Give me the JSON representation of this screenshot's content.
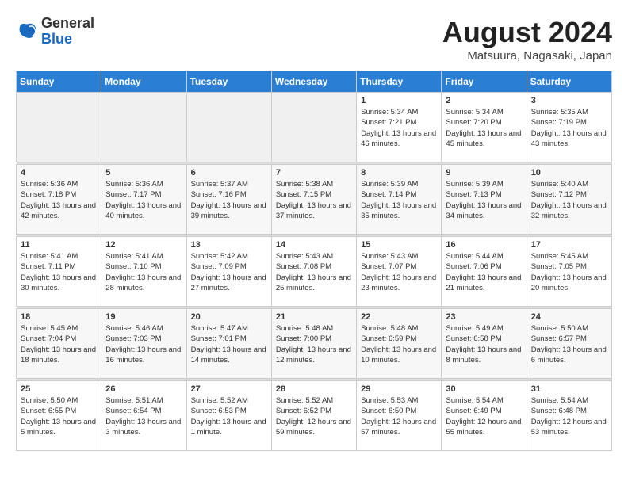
{
  "logo": {
    "general": "General",
    "blue": "Blue"
  },
  "header": {
    "month_year": "August 2024",
    "location": "Matsuura, Nagasaki, Japan"
  },
  "days_of_week": [
    "Sunday",
    "Monday",
    "Tuesday",
    "Wednesday",
    "Thursday",
    "Friday",
    "Saturday"
  ],
  "weeks": [
    [
      {
        "day": "",
        "empty": true
      },
      {
        "day": "",
        "empty": true
      },
      {
        "day": "",
        "empty": true
      },
      {
        "day": "",
        "empty": true
      },
      {
        "day": "1",
        "sunrise": "5:34 AM",
        "sunset": "7:21 PM",
        "daylight": "13 hours and 46 minutes."
      },
      {
        "day": "2",
        "sunrise": "5:34 AM",
        "sunset": "7:20 PM",
        "daylight": "13 hours and 45 minutes."
      },
      {
        "day": "3",
        "sunrise": "5:35 AM",
        "sunset": "7:19 PM",
        "daylight": "13 hours and 43 minutes."
      }
    ],
    [
      {
        "day": "4",
        "sunrise": "5:36 AM",
        "sunset": "7:18 PM",
        "daylight": "13 hours and 42 minutes."
      },
      {
        "day": "5",
        "sunrise": "5:36 AM",
        "sunset": "7:17 PM",
        "daylight": "13 hours and 40 minutes."
      },
      {
        "day": "6",
        "sunrise": "5:37 AM",
        "sunset": "7:16 PM",
        "daylight": "13 hours and 39 minutes."
      },
      {
        "day": "7",
        "sunrise": "5:38 AM",
        "sunset": "7:15 PM",
        "daylight": "13 hours and 37 minutes."
      },
      {
        "day": "8",
        "sunrise": "5:39 AM",
        "sunset": "7:14 PM",
        "daylight": "13 hours and 35 minutes."
      },
      {
        "day": "9",
        "sunrise": "5:39 AM",
        "sunset": "7:13 PM",
        "daylight": "13 hours and 34 minutes."
      },
      {
        "day": "10",
        "sunrise": "5:40 AM",
        "sunset": "7:12 PM",
        "daylight": "13 hours and 32 minutes."
      }
    ],
    [
      {
        "day": "11",
        "sunrise": "5:41 AM",
        "sunset": "7:11 PM",
        "daylight": "13 hours and 30 minutes."
      },
      {
        "day": "12",
        "sunrise": "5:41 AM",
        "sunset": "7:10 PM",
        "daylight": "13 hours and 28 minutes."
      },
      {
        "day": "13",
        "sunrise": "5:42 AM",
        "sunset": "7:09 PM",
        "daylight": "13 hours and 27 minutes."
      },
      {
        "day": "14",
        "sunrise": "5:43 AM",
        "sunset": "7:08 PM",
        "daylight": "13 hours and 25 minutes."
      },
      {
        "day": "15",
        "sunrise": "5:43 AM",
        "sunset": "7:07 PM",
        "daylight": "13 hours and 23 minutes."
      },
      {
        "day": "16",
        "sunrise": "5:44 AM",
        "sunset": "7:06 PM",
        "daylight": "13 hours and 21 minutes."
      },
      {
        "day": "17",
        "sunrise": "5:45 AM",
        "sunset": "7:05 PM",
        "daylight": "13 hours and 20 minutes."
      }
    ],
    [
      {
        "day": "18",
        "sunrise": "5:45 AM",
        "sunset": "7:04 PM",
        "daylight": "13 hours and 18 minutes."
      },
      {
        "day": "19",
        "sunrise": "5:46 AM",
        "sunset": "7:03 PM",
        "daylight": "13 hours and 16 minutes."
      },
      {
        "day": "20",
        "sunrise": "5:47 AM",
        "sunset": "7:01 PM",
        "daylight": "13 hours and 14 minutes."
      },
      {
        "day": "21",
        "sunrise": "5:48 AM",
        "sunset": "7:00 PM",
        "daylight": "13 hours and 12 minutes."
      },
      {
        "day": "22",
        "sunrise": "5:48 AM",
        "sunset": "6:59 PM",
        "daylight": "13 hours and 10 minutes."
      },
      {
        "day": "23",
        "sunrise": "5:49 AM",
        "sunset": "6:58 PM",
        "daylight": "13 hours and 8 minutes."
      },
      {
        "day": "24",
        "sunrise": "5:50 AM",
        "sunset": "6:57 PM",
        "daylight": "13 hours and 6 minutes."
      }
    ],
    [
      {
        "day": "25",
        "sunrise": "5:50 AM",
        "sunset": "6:55 PM",
        "daylight": "13 hours and 5 minutes."
      },
      {
        "day": "26",
        "sunrise": "5:51 AM",
        "sunset": "6:54 PM",
        "daylight": "13 hours and 3 minutes."
      },
      {
        "day": "27",
        "sunrise": "5:52 AM",
        "sunset": "6:53 PM",
        "daylight": "13 hours and 1 minute."
      },
      {
        "day": "28",
        "sunrise": "5:52 AM",
        "sunset": "6:52 PM",
        "daylight": "12 hours and 59 minutes."
      },
      {
        "day": "29",
        "sunrise": "5:53 AM",
        "sunset": "6:50 PM",
        "daylight": "12 hours and 57 minutes."
      },
      {
        "day": "30",
        "sunrise": "5:54 AM",
        "sunset": "6:49 PM",
        "daylight": "12 hours and 55 minutes."
      },
      {
        "day": "31",
        "sunrise": "5:54 AM",
        "sunset": "6:48 PM",
        "daylight": "12 hours and 53 minutes."
      }
    ]
  ]
}
